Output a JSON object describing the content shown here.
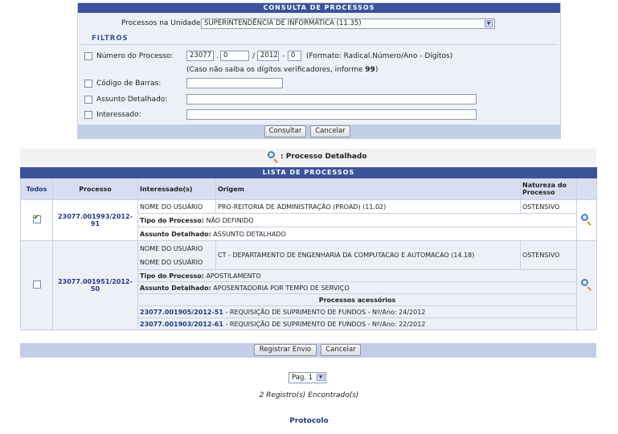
{
  "consulta": {
    "title": "Consulta de Processos",
    "unidade_label": "Processos na Unidade:",
    "unidade_value": "SUPERINTENDÊNCIA DE INFORMÁTICA (11.35)",
    "filtros_title": "Filtros",
    "numero_label": "Número do Processo:",
    "numero_radical": "23077",
    "numero_num": "0",
    "numero_ano": "2012",
    "numero_dig": "0",
    "numero_sep1": ".",
    "numero_sep2": "/",
    "numero_sep3": "-",
    "numero_hint": "(Formato: Radical.Número/Ano - Dígitos)",
    "digitos_hint_pre": "(Caso não saiba os dígitos verificadores, informe ",
    "digitos_hint_num": "99",
    "digitos_hint_post": ")",
    "codigo_label": "Código de Barras:",
    "assunto_label": "Assunto Detalhado:",
    "interessado_label": "Interessado:",
    "consultar_label": "Consultar",
    "cancelar_label": "Cancelar"
  },
  "detalhado_label": ": Processo Detalhado",
  "lista": {
    "title": "Lista de Processos",
    "headers": {
      "todos": "Todos",
      "processo": "Processo",
      "interessados": "Interessado(s)",
      "origem": "Origem",
      "natureza": "Natureza do Processo"
    },
    "rows": [
      {
        "processo": "23077.001993/2012-91",
        "interessado": "NOME DO USUÁRIO",
        "origem": "PRO-REITORIA DE ADMINISTRAÇÃO (PROAD) (11.02)",
        "natureza": "OSTENSIVO",
        "tipo_label": "Tipo do Processo:",
        "tipo_value": "NÃO DEFINIDO",
        "assunto_label": "Assunto Detalhado:",
        "assunto_value": "ASSUNTO DETALHADO"
      },
      {
        "processo": "23077.001951/2012-50",
        "interessado1": "NOME DO USUÁRIO",
        "interessado2": "NOME DO USUÁRIO",
        "origem": "CT - DEPARTAMENTO DE ENGENHARIA DA COMPUTACAO E AUTOMACAO (14.18)",
        "natureza": "OSTENSIVO",
        "tipo_label": "Tipo do Processo:",
        "tipo_value": "APOSTILAMENTO",
        "assunto_label": "Assunto Detalhado:",
        "assunto_value": "APOSENTADORIA POR TEMPO DE SERVIÇO",
        "acessorios_title": "Processos acessórios",
        "acessorios": [
          {
            "numero": "23077.001905/2012-51",
            "desc": " - REQUISIÇÃO DE SUPRIMENTO DE FUNDOS - Nº/Ano: 24/2012"
          },
          {
            "numero": "23077.001903/2012-61",
            "desc": " - REQUISIÇÃO DE SUPRIMENTO DE FUNDOS - Nº/Ano: 22/2012"
          }
        ]
      }
    ],
    "registrar_label": "Registrar Envio",
    "cancelar_label": "Cancelar"
  },
  "pagination": {
    "page_label": "Pag. 1"
  },
  "registros": "2 Registro(s) Encontrado(s)",
  "footer_link": "Protocolo",
  "icons": {
    "detalhe": "magnifier-icon",
    "select": "chevron-down-icon",
    "check": "checkbox-checked"
  },
  "colors": {
    "header_blue": "#3a539a",
    "light_panel": "#eef0f8",
    "footer_bar": "#c4cde6",
    "link": "#1c3a85"
  }
}
